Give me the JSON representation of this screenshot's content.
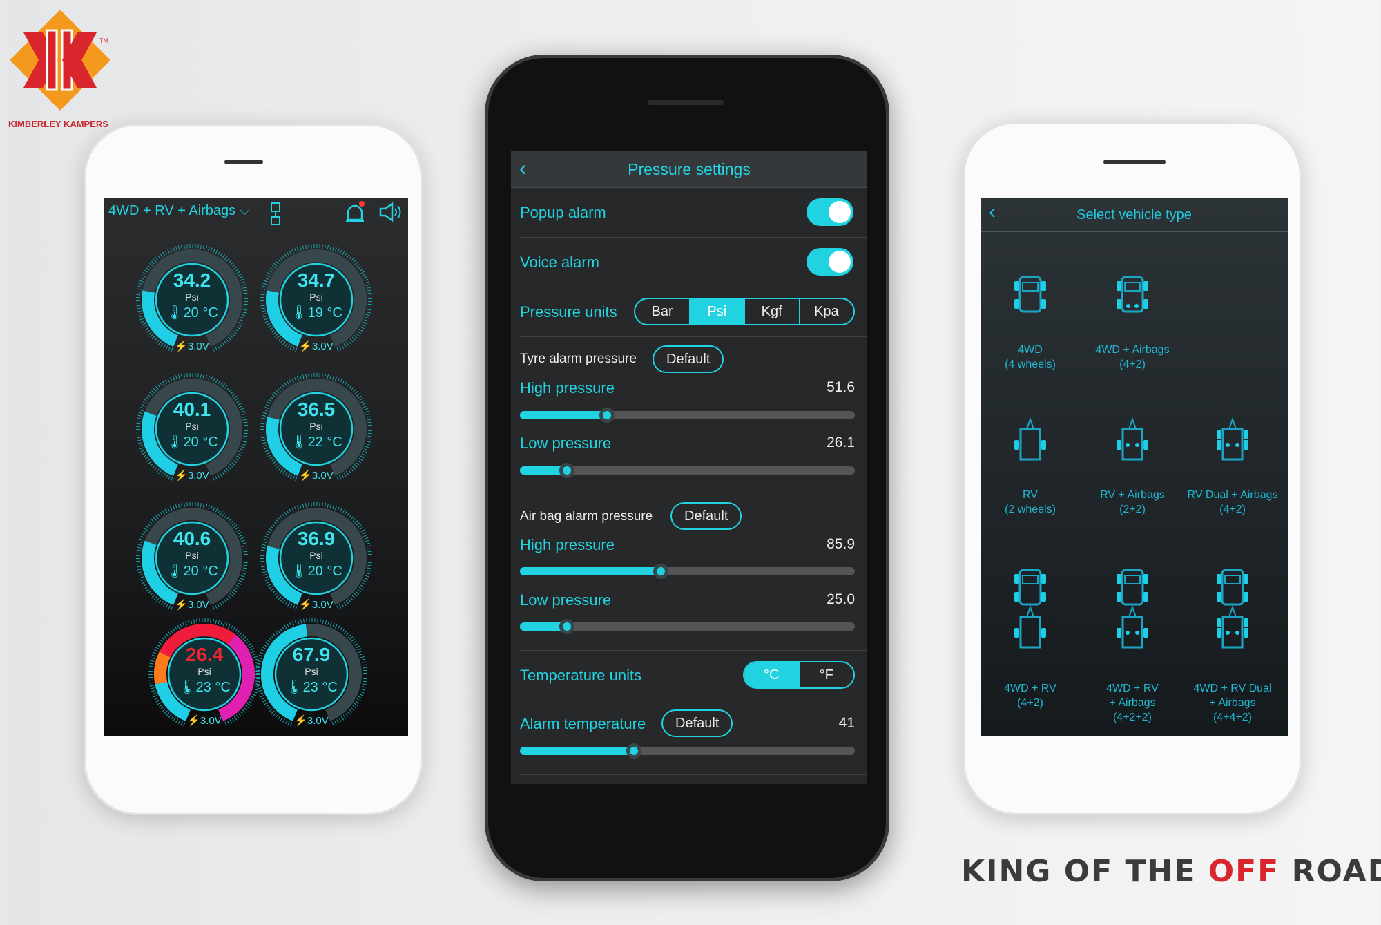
{
  "brand": {
    "logo_text": "KIMBERLEY KAMPERS",
    "trademark": "TM",
    "slogan_parts": [
      "KING OF THE ",
      "OFF",
      " ROAD"
    ],
    "slogan_tm": "™",
    "colors": {
      "red": "#d9262c",
      "orange": "#f39a1e"
    }
  },
  "accent": "#21d3e0",
  "left_phone": {
    "vehicle_select": "4WD + RV + Airbags",
    "icons": [
      "vehicle-layout-icon",
      "alarm-bell-icon",
      "speaker-icon"
    ],
    "alarm_badge_color": "#ff3b30",
    "scale_ticks": [
      "2",
      "3",
      "4",
      "5",
      "6",
      "8",
      "10",
      "12",
      "14"
    ],
    "gauges": [
      {
        "pressure": "34.2",
        "unit": "Psi",
        "temp": "20 °C",
        "voltage": "3.0V",
        "level": 0.25,
        "alert": false
      },
      {
        "pressure": "34.7",
        "unit": "Psi",
        "temp": "19 °C",
        "voltage": "3.0V",
        "level": 0.25,
        "alert": false
      },
      {
        "pressure": "40.1",
        "unit": "Psi",
        "temp": "20 °C",
        "voltage": "3.0V",
        "level": 0.28,
        "alert": false
      },
      {
        "pressure": "36.5",
        "unit": "Psi",
        "temp": "22 °C",
        "voltage": "3.0V",
        "level": 0.26,
        "alert": false
      },
      {
        "pressure": "40.6",
        "unit": "Psi",
        "temp": "20 °C",
        "voltage": "3.0V",
        "level": 0.28,
        "alert": false
      },
      {
        "pressure": "36.9",
        "unit": "Psi",
        "temp": "20 °C",
        "voltage": "3.0V",
        "level": 0.26,
        "alert": false
      },
      {
        "pressure": "26.4",
        "unit": "Psi",
        "temp": "23 °C",
        "voltage": "3.0V",
        "level": 0.18,
        "alert": true
      },
      {
        "pressure": "67.9",
        "unit": "Psi",
        "temp": "23 °C",
        "voltage": "3.0V",
        "level": 0.48,
        "alert": false
      }
    ]
  },
  "settings": {
    "title": "Pressure settings",
    "popup_alarm": {
      "label": "Popup alarm",
      "on": true
    },
    "voice_alarm": {
      "label": "Voice alarm",
      "on": true
    },
    "pressure_units": {
      "label": "Pressure units",
      "options": [
        "Bar",
        "Psi",
        "Kgf",
        "Kpa"
      ],
      "selected": "Psi"
    },
    "tyre": {
      "label": "Tyre alarm pressure",
      "default_label": "Default",
      "high_label": "High pressure",
      "high": "51.6",
      "high_frac": 0.26,
      "low_label": "Low pressure",
      "low": "26.1",
      "low_frac": 0.14
    },
    "airbag": {
      "label": "Air bag alarm pressure",
      "default_label": "Default",
      "high_label": "High pressure",
      "high": "85.9",
      "high_frac": 0.42,
      "low_label": "Low pressure",
      "low": "25.0",
      "low_frac": 0.14
    },
    "temp_units": {
      "label": "Temperature units",
      "options": [
        "°C",
        "°F"
      ],
      "selected": "°C"
    },
    "alarm_temp": {
      "label": "Alarm temperature",
      "default_label": "Default",
      "value": "41",
      "frac": 0.34
    }
  },
  "vehicle_select": {
    "title": "Select vehicle type",
    "types": [
      {
        "line1": "4WD",
        "line2": "(4 wheels)",
        "line3": ""
      },
      {
        "line1": "4WD + Airbags",
        "line2": "(4+2)",
        "line3": ""
      },
      {
        "line1": "RV",
        "line2": "(2 wheels)",
        "line3": ""
      },
      {
        "line1": "RV + Airbags",
        "line2": "(2+2)",
        "line3": ""
      },
      {
        "line1": "RV Dual + Airbags",
        "line2": "(4+2)",
        "line3": ""
      },
      {
        "line1": "4WD + RV",
        "line2": "(4+2)",
        "line3": ""
      },
      {
        "line1": "4WD + RV",
        "line2": "+ Airbags",
        "line3": "(4+2+2)"
      },
      {
        "line1": "4WD + RV Dual",
        "line2": "+ Airbags",
        "line3": "(4+4+2)"
      }
    ]
  }
}
